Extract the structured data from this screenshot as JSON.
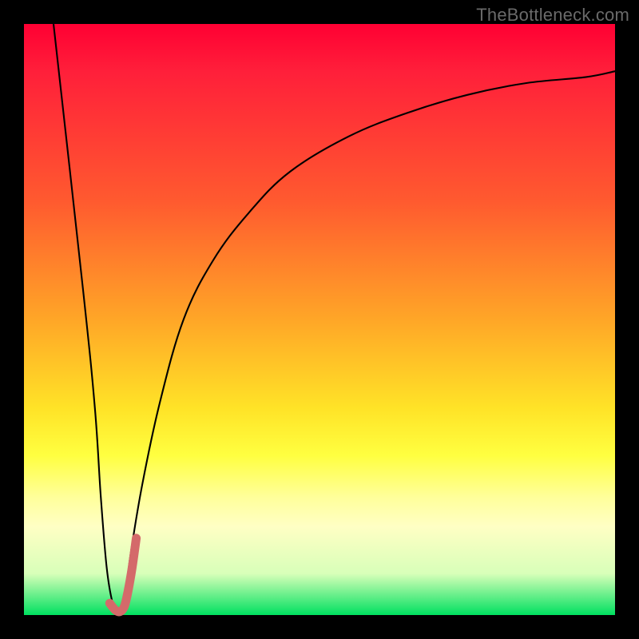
{
  "watermark": "TheBottleneck.com",
  "chart_data": {
    "type": "line",
    "title": "",
    "xlabel": "",
    "ylabel": "",
    "xlim": [
      0,
      100
    ],
    "ylim": [
      0,
      100
    ],
    "grid": false,
    "legend": null,
    "background_gradient": {
      "stops": [
        {
          "pos": 0,
          "color": "#ff0033"
        },
        {
          "pos": 30,
          "color": "#ff5a2f"
        },
        {
          "pos": 50,
          "color": "#ffa627"
        },
        {
          "pos": 73,
          "color": "#ffff40"
        },
        {
          "pos": 85,
          "color": "#ffffc4"
        },
        {
          "pos": 100,
          "color": "#00e060"
        }
      ]
    },
    "series": [
      {
        "name": "main-curve",
        "color": "#000000",
        "stroke_width": 2.1,
        "x": [
          5,
          10,
          12,
          13,
          14,
          15,
          16,
          17,
          18,
          20,
          23,
          27,
          32,
          38,
          45,
          55,
          65,
          75,
          85,
          95,
          100
        ],
        "values": [
          100,
          55,
          35,
          20,
          8,
          2,
          0,
          2,
          10,
          22,
          36,
          50,
          60,
          68,
          75,
          81,
          85,
          88,
          90,
          91,
          92
        ]
      },
      {
        "name": "highlight-segment",
        "color": "#d46a6a",
        "stroke_width": 11,
        "x": [
          14.5,
          15.5,
          16.3,
          17.0,
          17.6,
          18.3,
          19.0
        ],
        "values": [
          2.0,
          0.8,
          0.6,
          1.5,
          4.0,
          8.0,
          13.0
        ]
      }
    ]
  }
}
